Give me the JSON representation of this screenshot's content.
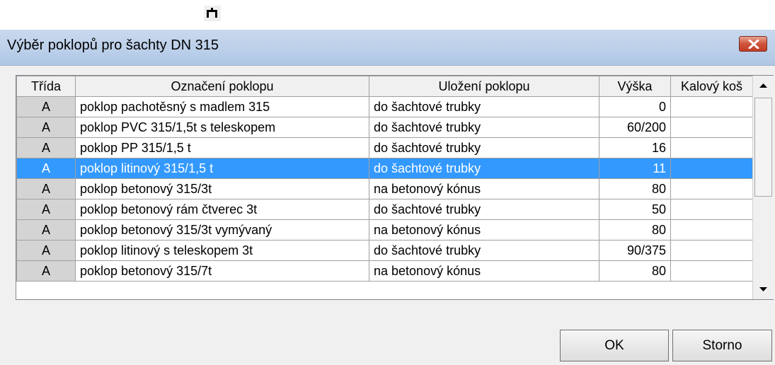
{
  "window": {
    "title": "Výběr poklopů pro šachty DN 315"
  },
  "columns": [
    "Třída",
    "Označení poklopu",
    "Uložení poklopu",
    "Výška",
    "Kalový koš"
  ],
  "rows": [
    {
      "trida": "A",
      "oznaceni": "poklop pachotěsný s madlem 315",
      "ulozeni": "do šachtové trubky",
      "vyska": "0",
      "kos": ""
    },
    {
      "trida": "A",
      "oznaceni": "poklop PVC 315/1,5t s teleskopem",
      "ulozeni": "do šachtové trubky",
      "vyska": "60/200",
      "kos": ""
    },
    {
      "trida": "A",
      "oznaceni": "poklop PP 315/1,5 t",
      "ulozeni": "do šachtové trubky",
      "vyska": "16",
      "kos": ""
    },
    {
      "trida": "A",
      "oznaceni": "poklop litinový 315/1,5 t",
      "ulozeni": "do šachtové trubky",
      "vyska": "11",
      "kos": "",
      "selected": true
    },
    {
      "trida": "A",
      "oznaceni": "poklop betonový 315/3t",
      "ulozeni": "na betonový kónus",
      "vyska": "80",
      "kos": ""
    },
    {
      "trida": "A",
      "oznaceni": "poklop betonový rám čtverec 3t",
      "ulozeni": "do šachtové trubky",
      "vyska": "50",
      "kos": ""
    },
    {
      "trida": "A",
      "oznaceni": "poklop betonový 315/3t vymývaný",
      "ulozeni": "na betonový kónus",
      "vyska": "80",
      "kos": ""
    },
    {
      "trida": "A",
      "oznaceni": "poklop litinový s teleskopem 3t",
      "ulozeni": "do šachtové trubky",
      "vyska": "90/375",
      "kos": ""
    },
    {
      "trida": "A",
      "oznaceni": "poklop betonový 315/7t",
      "ulozeni": "na betonový kónus",
      "vyska": "80",
      "kos": ""
    }
  ],
  "buttons": {
    "ok": "OK",
    "cancel": "Storno"
  },
  "colors": {
    "selection": "#3399ff",
    "titlebar": "#bcd0ea",
    "close": "#c8452c"
  },
  "icons": {
    "top": "manhole-icon",
    "close": "close-icon",
    "scroll_up": "arrow-up-icon",
    "scroll_down": "arrow-down-icon"
  }
}
